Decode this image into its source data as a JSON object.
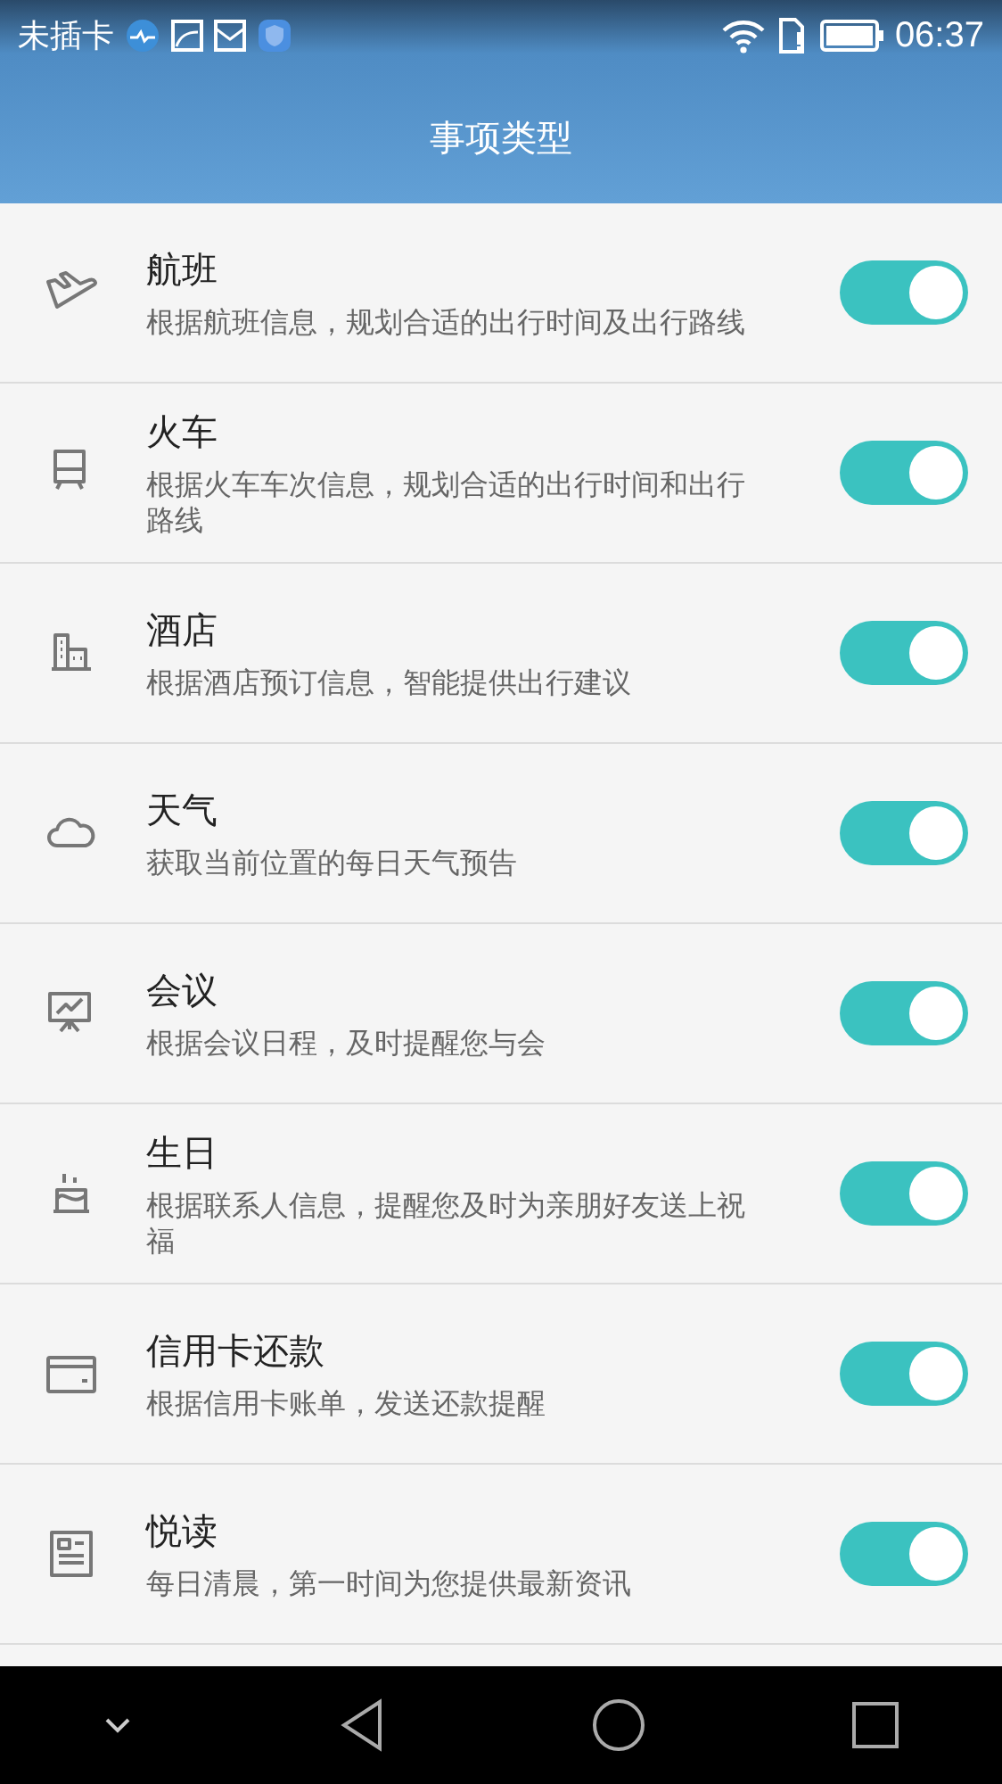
{
  "status_bar": {
    "carrier": "未插卡",
    "time": "06:37"
  },
  "header": {
    "title": "事项类型"
  },
  "items": [
    {
      "kind": "plane",
      "title": "航班",
      "description": "根据航班信息，规划合适的出行时间及出行路线",
      "on": true
    },
    {
      "kind": "train",
      "title": "火车",
      "description": "根据火车车次信息，规划合适的出行时间和出行路线",
      "on": true
    },
    {
      "kind": "hotel",
      "title": "酒店",
      "description": "根据酒店预订信息，智能提供出行建议",
      "on": true
    },
    {
      "kind": "cloud",
      "title": "天气",
      "description": "获取当前位置的每日天气预告",
      "on": true
    },
    {
      "kind": "meeting",
      "title": "会议",
      "description": "根据会议日程，及时提醒您与会",
      "on": true
    },
    {
      "kind": "cake",
      "title": "生日",
      "description": "根据联系人信息，提醒您及时为亲朋好友送上祝福",
      "on": true
    },
    {
      "kind": "card",
      "title": "信用卡还款",
      "description": "根据信用卡账单，发送还款提醒",
      "on": true
    },
    {
      "kind": "news",
      "title": "悦读",
      "description": "每日清晨，第一时间为您提供最新资讯",
      "on": true
    }
  ]
}
